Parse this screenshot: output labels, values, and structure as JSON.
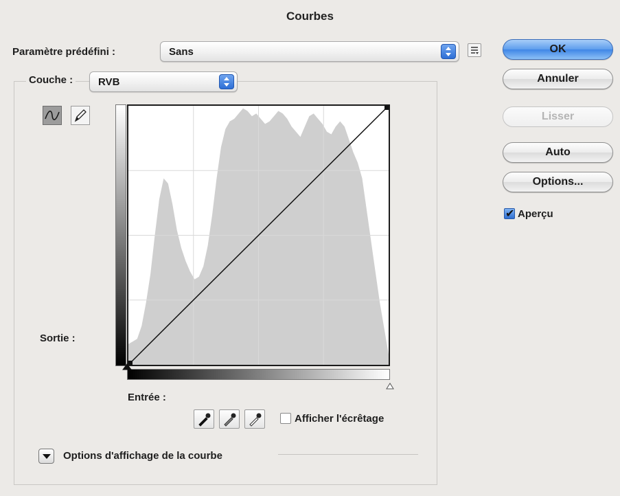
{
  "window": {
    "title": "Courbes"
  },
  "preset": {
    "label": "Paramètre prédéfini :",
    "value": "Sans"
  },
  "channel": {
    "label": "Couche :",
    "value": "RVB"
  },
  "buttons": {
    "ok": "OK",
    "cancel": "Annuler",
    "smooth": "Lisser",
    "auto": "Auto",
    "options": "Options..."
  },
  "preview": {
    "label": "Aperçu",
    "checked": true
  },
  "curve": {
    "output_label": "Sortie :",
    "input_label": "Entrée :",
    "show_clipping_label": "Afficher l'écrêtage",
    "display_options_label": "Options d'affichage de la courbe",
    "histogram": [
      8,
      9,
      10,
      15,
      24,
      35,
      50,
      64,
      72,
      70,
      62,
      52,
      45,
      40,
      36,
      33,
      34,
      38,
      46,
      58,
      72,
      84,
      91,
      94,
      95,
      97,
      99,
      98,
      96,
      97,
      95,
      93,
      94,
      96,
      98,
      97,
      95,
      92,
      90,
      88,
      92,
      96,
      97,
      95,
      93,
      90,
      89,
      92,
      94,
      92,
      87,
      82,
      78,
      72,
      60,
      48,
      36,
      24,
      14,
      4
    ]
  }
}
